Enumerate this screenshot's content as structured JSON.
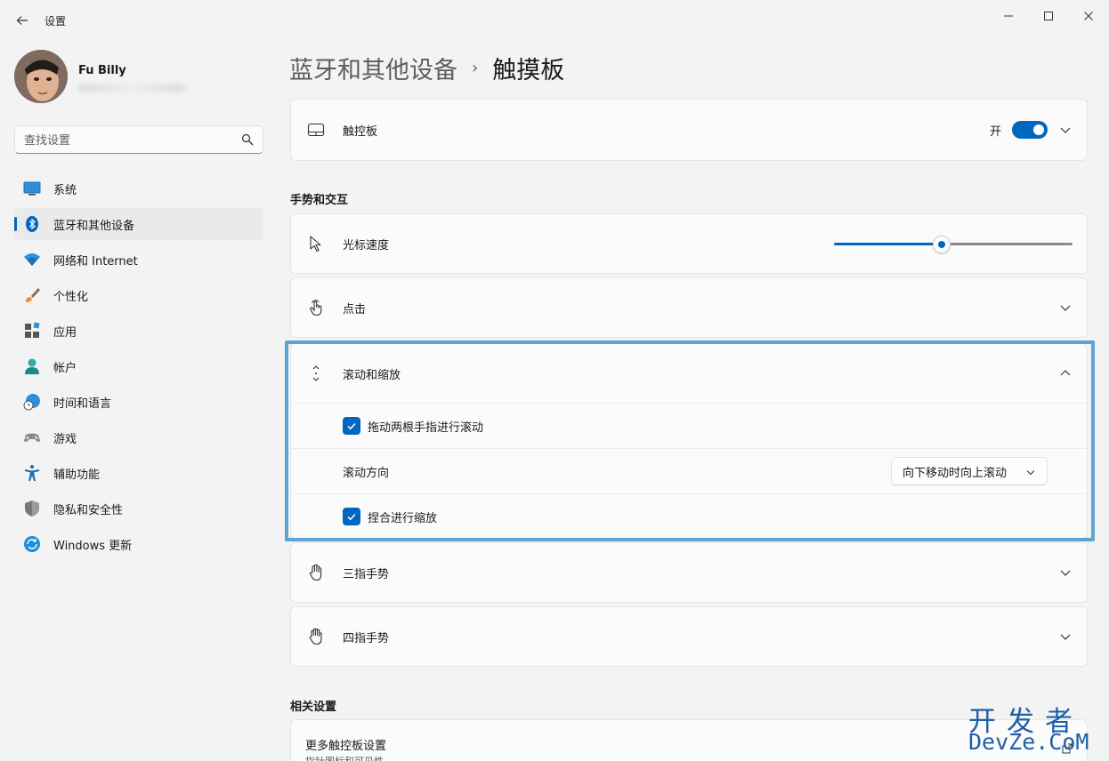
{
  "window": {
    "title": "设置",
    "minimize_glyph": "—",
    "maximize_glyph": "☐",
    "close_glyph": "✕"
  },
  "profile": {
    "name": "Fu Billy"
  },
  "search": {
    "placeholder": "查找设置"
  },
  "sidebar": {
    "items": [
      {
        "label": "系统",
        "icon": "monitor-icon"
      },
      {
        "label": "蓝牙和其他设备",
        "icon": "bluetooth-icon",
        "active": true
      },
      {
        "label": "网络和 Internet",
        "icon": "wifi-icon"
      },
      {
        "label": "个性化",
        "icon": "brush-icon"
      },
      {
        "label": "应用",
        "icon": "apps-icon"
      },
      {
        "label": "帐户",
        "icon": "person-icon"
      },
      {
        "label": "时间和语言",
        "icon": "globe-clock-icon"
      },
      {
        "label": "游戏",
        "icon": "gamepad-icon"
      },
      {
        "label": "辅助功能",
        "icon": "accessibility-icon"
      },
      {
        "label": "隐私和安全性",
        "icon": "shield-icon"
      },
      {
        "label": "Windows 更新",
        "icon": "update-icon"
      }
    ]
  },
  "breadcrumb": {
    "parent": "蓝牙和其他设备",
    "separator": "›",
    "current": "触摸板"
  },
  "touchpad": {
    "label": "触控板",
    "toggle_state": "开",
    "enabled": true
  },
  "gestures": {
    "section_title": "手势和交互",
    "cursor_speed": {
      "label": "光标速度",
      "value": 0.45
    },
    "tap": {
      "label": "点击"
    },
    "scroll_zoom": {
      "label": "滚动和缩放",
      "two_finger_scroll": {
        "label": "拖动两根手指进行滚动",
        "checked": true
      },
      "scroll_direction": {
        "label": "滚动方向",
        "value": "向下移动时向上滚动"
      },
      "pinch_zoom": {
        "label": "捏合进行缩放",
        "checked": true
      }
    },
    "three_finger": {
      "label": "三指手势"
    },
    "four_finger": {
      "label": "四指手势"
    }
  },
  "related": {
    "section_title": "相关设置",
    "more_touchpad": {
      "label": "更多触控板设置",
      "sublabel": "指针图标和可见性"
    }
  },
  "watermark": {
    "cn": "开发者",
    "en": "DevZe.CoM"
  },
  "colors": {
    "accent": "#0067c0",
    "highlight": "#5ba5d3",
    "background": "#f3f3f3"
  }
}
